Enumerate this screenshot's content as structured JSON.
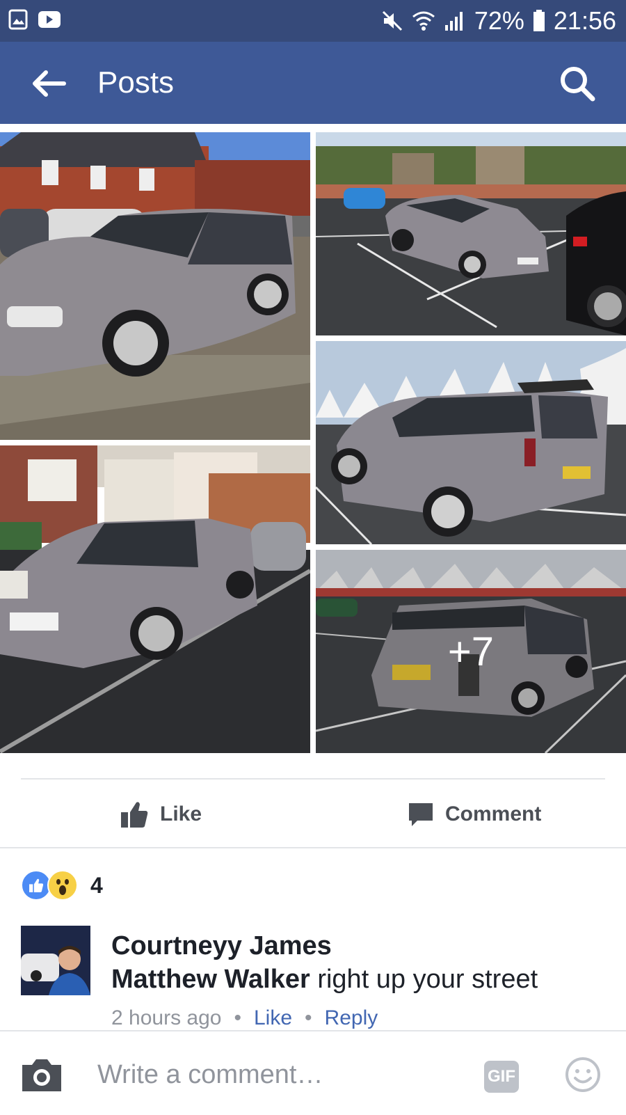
{
  "status_bar": {
    "battery": "72%",
    "time": "21:56",
    "icons": [
      "gallery-icon",
      "video-icon",
      "mute-icon",
      "wifi-icon",
      "signal-icon",
      "battery-icon"
    ]
  },
  "header": {
    "title": "Posts",
    "back_icon": "back-arrow-icon",
    "search_icon": "search-icon",
    "color": "#3e5997"
  },
  "photos": {
    "more_count": "+7"
  },
  "actions": {
    "like_label": "Like",
    "comment_label": "Comment"
  },
  "reactions": {
    "types": [
      "like",
      "wow"
    ],
    "count": "4"
  },
  "comment": {
    "author": "Courtneyy James",
    "mention": "Matthew Walker",
    "text": " right up your street",
    "time": "2 hours ago",
    "like_label": "Like",
    "reply_label": "Reply",
    "separator": "•"
  },
  "composer": {
    "placeholder": "Write a comment…",
    "gif_label": "GIF"
  },
  "colors": {
    "status_bar": "#364a7a",
    "brand": "#3e5997",
    "link": "#4267b2"
  }
}
